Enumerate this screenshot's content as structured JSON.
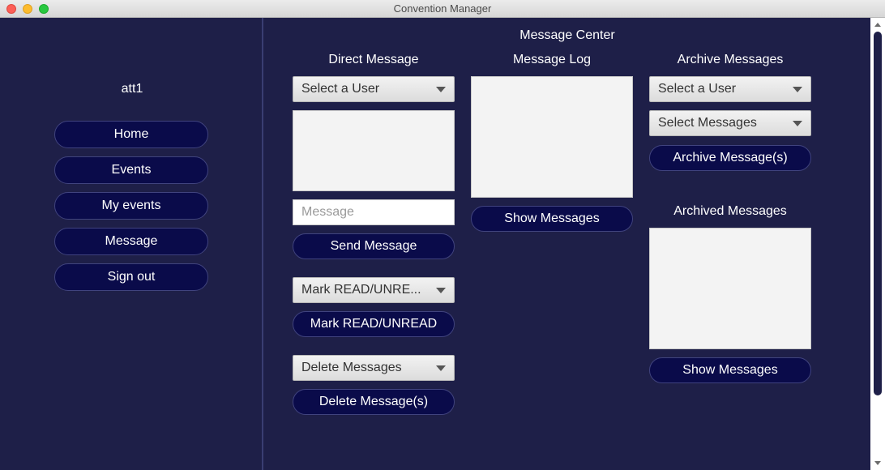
{
  "window": {
    "title": "Convention Manager"
  },
  "sidebar": {
    "username": "att1",
    "items": [
      {
        "label": "Home"
      },
      {
        "label": "Events"
      },
      {
        "label": "My events"
      },
      {
        "label": "Message"
      },
      {
        "label": "Sign out"
      }
    ]
  },
  "main": {
    "title": "Message Center",
    "direct": {
      "heading": "Direct Message",
      "user_select": "Select a User",
      "message_placeholder": "Message",
      "send_label": "Send Message",
      "mark_select": "Mark READ/UNRE...",
      "mark_button": "Mark READ/UNREAD",
      "delete_select": "Delete Messages",
      "delete_button": "Delete Message(s)"
    },
    "log": {
      "heading": "Message Log",
      "show_button": "Show Messages"
    },
    "archive": {
      "heading": "Archive Messages",
      "user_select": "Select a User",
      "messages_select": "Select Messages",
      "archive_button": "Archive Message(s)",
      "archived_heading": "Archived Messages",
      "show_button": "Show Messages"
    }
  }
}
